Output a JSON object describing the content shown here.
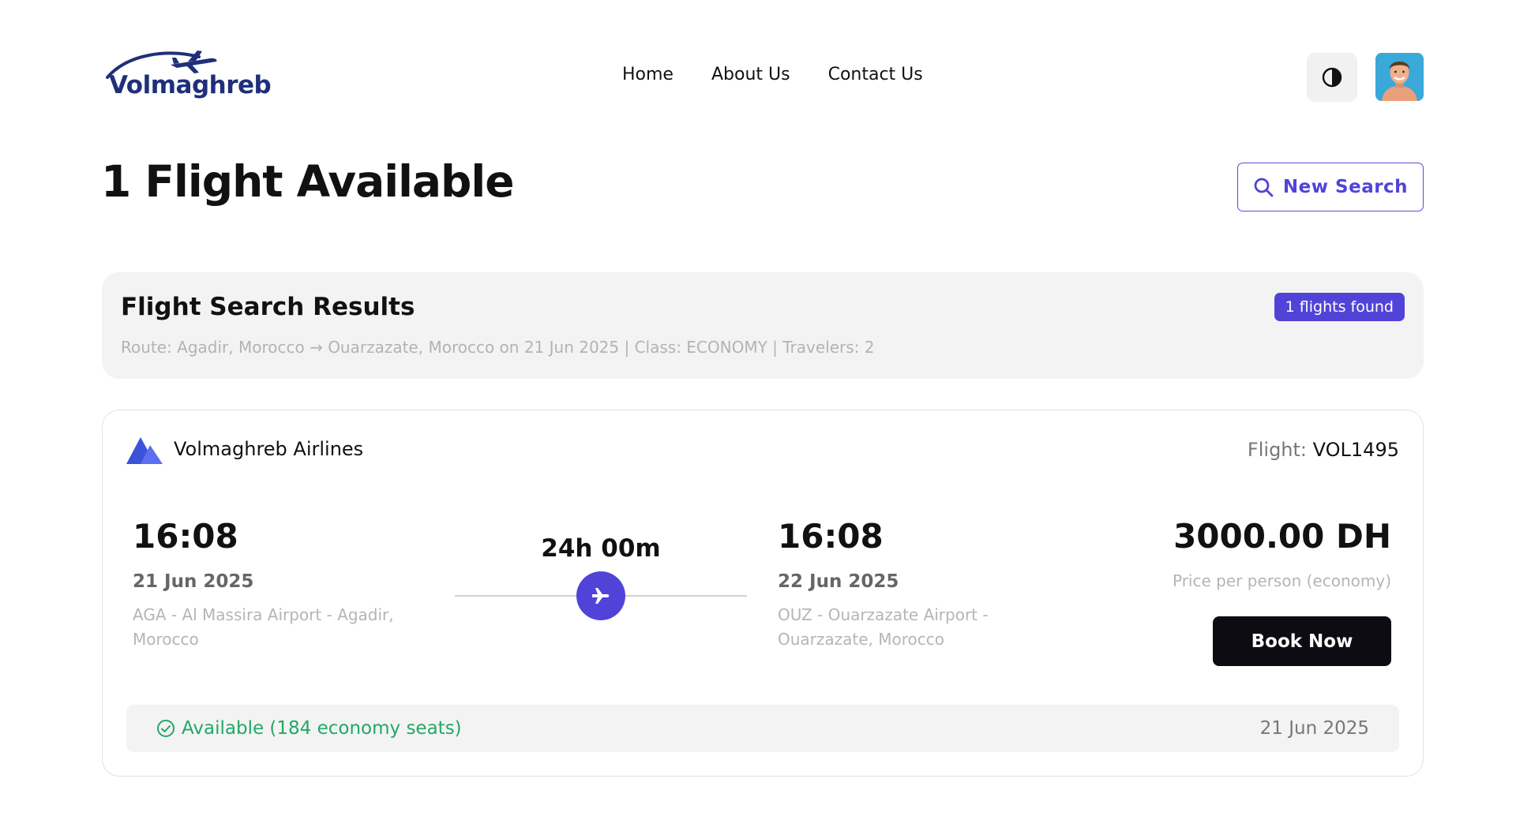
{
  "brand": {
    "name": "Volmaghreb",
    "primary_color": "#5243d8",
    "logo_color": "#1f2f7a"
  },
  "nav": {
    "items": [
      "Home",
      "About Us",
      "Contact Us"
    ]
  },
  "header": {
    "theme_icon": "contrast-icon",
    "avatar": "user-avatar"
  },
  "page": {
    "title": "1 Flight Available",
    "new_search_label": "New Search",
    "new_search_icon": "search-icon"
  },
  "summary": {
    "title": "Flight Search Results",
    "route_text": "Route: Agadir, Morocco → Ouarzazate, Morocco on 21 Jun 2025 | Class: ECONOMY | Travelers: 2",
    "badge": "1 flights found"
  },
  "flight": {
    "airline": "Volmaghreb Airlines",
    "flight_label": "Flight:",
    "flight_number": "VOL1495",
    "departure": {
      "time": "16:08",
      "date": "21 Jun 2025",
      "airport": "AGA - Al Massira Airport - Agadir, Morocco"
    },
    "duration": "24h 00m",
    "arrival": {
      "time": "16:08",
      "date": "22 Jun 2025",
      "airport": "OUZ - Ouarzazate Airport - Ouarzazate, Morocco"
    },
    "price": "3000.00 DH",
    "price_note": "Price per person (economy)",
    "book_label": "Book Now",
    "availability": "Available (184 economy seats)",
    "availability_color": "#22a867",
    "availability_date": "21 Jun 2025"
  }
}
